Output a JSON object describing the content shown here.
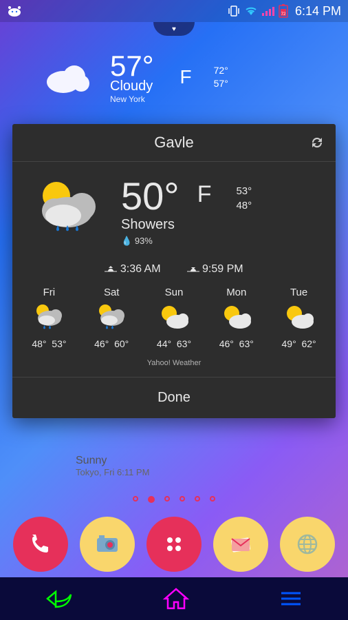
{
  "status": {
    "time": "6:14 PM",
    "battery": "72"
  },
  "bg_widget": {
    "temp": "57°",
    "unit": "F",
    "cond": "Cloudy",
    "loc": "New York",
    "hi": "72°",
    "lo": "57°"
  },
  "popup": {
    "city": "Gavle",
    "now": {
      "temp": "50°",
      "unit": "F",
      "cond": "Showers",
      "humidity": "93%",
      "hi": "53°",
      "lo": "48°"
    },
    "sunrise": "3:36 AM",
    "sunset": "9:59 PM",
    "forecast": [
      {
        "day": "Fri",
        "lo": "48°",
        "hi": "53°",
        "icon": "showers"
      },
      {
        "day": "Sat",
        "lo": "46°",
        "hi": "60°",
        "icon": "showers"
      },
      {
        "day": "Sun",
        "lo": "44°",
        "hi": "63°",
        "icon": "partly"
      },
      {
        "day": "Mon",
        "lo": "46°",
        "hi": "63°",
        "icon": "partly"
      },
      {
        "day": "Tue",
        "lo": "49°",
        "hi": "62°",
        "icon": "partly"
      }
    ],
    "attrib": "Yahoo! Weather",
    "done": "Done"
  },
  "below": {
    "cond": "Sunny",
    "detail": "Tokyo, Fri 6:11 PM"
  },
  "dock": [
    "phone",
    "camera",
    "apps",
    "mail",
    "globe"
  ]
}
